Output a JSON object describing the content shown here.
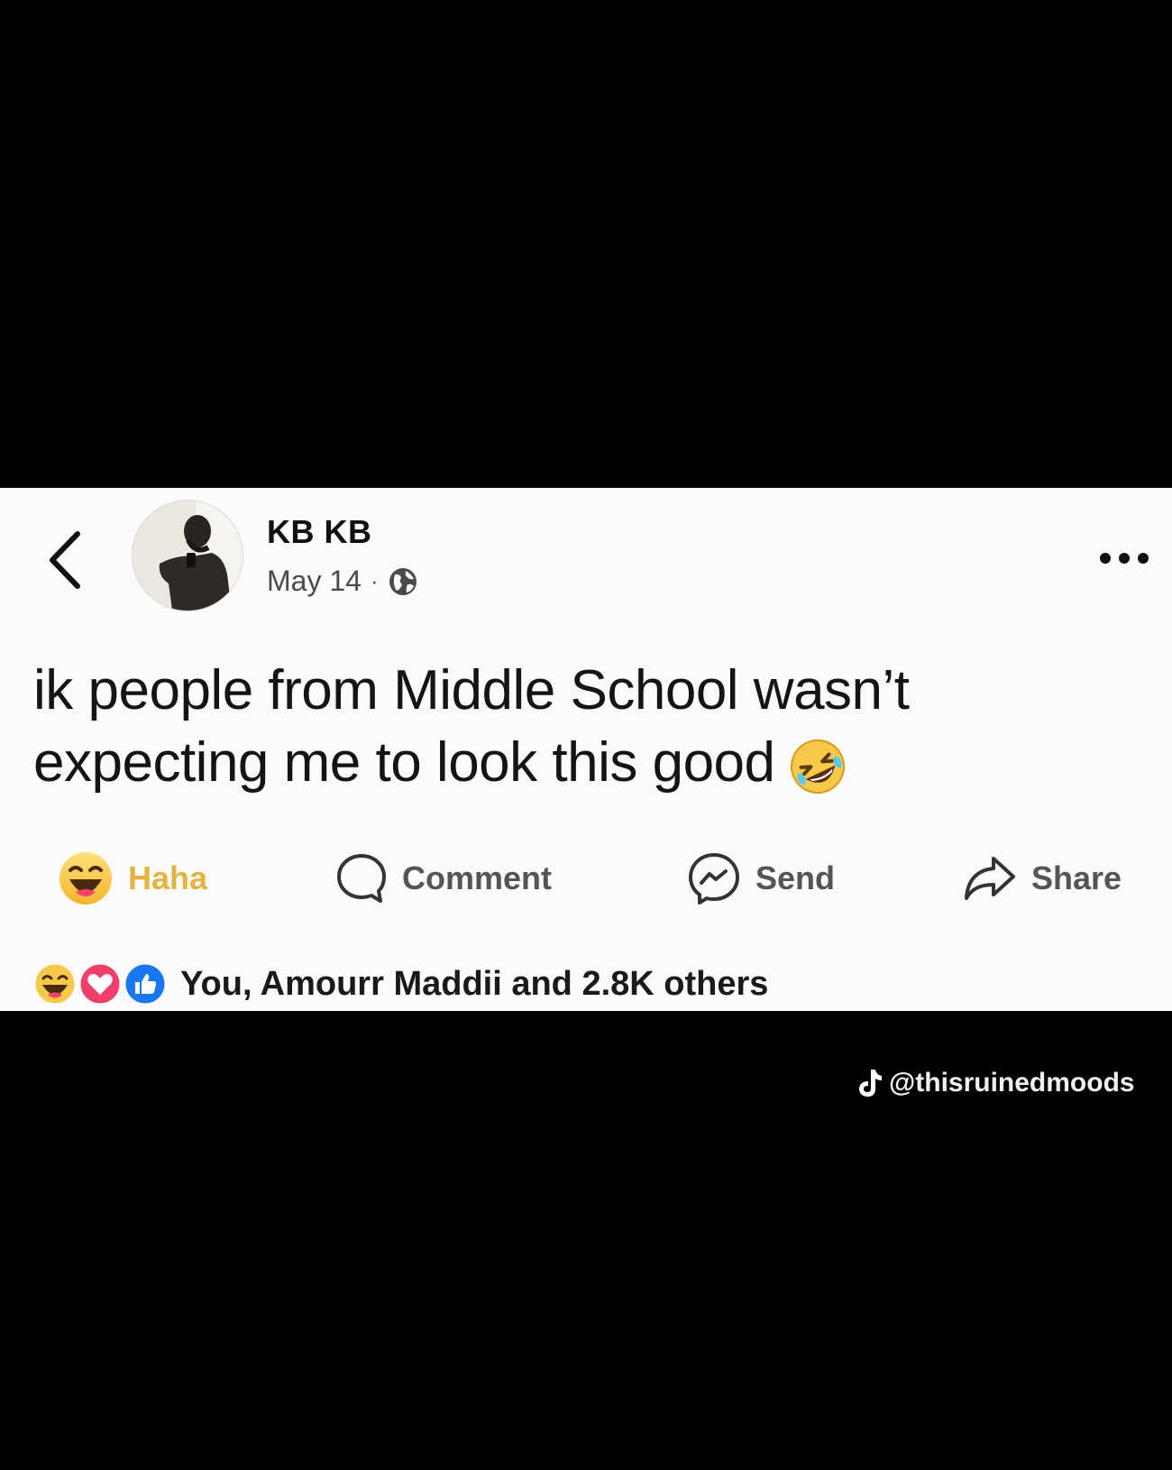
{
  "post": {
    "author": "KB KB",
    "date": "May 14",
    "separator": "·",
    "text_line1": "ik people from Middle School wasn’t",
    "text_line2": "expecting me to look this good"
  },
  "icons": {
    "back": "chevron-left-icon",
    "privacy": "globe-icon",
    "more": "more-horizontal-icon",
    "post_emoji": "rolling-on-floor-laughing-emoji",
    "haha": "haha-reaction-icon",
    "comment": "comment-bubble-icon",
    "send": "messenger-icon",
    "share": "share-arrow-icon",
    "tiktok": "tiktok-logo-icon"
  },
  "actions": {
    "haha_label": "Haha",
    "comment_label": "Comment",
    "send_label": "Send",
    "share_label": "Share"
  },
  "reactions": {
    "summary": "You, Amourr Maddii and 2.8K others"
  },
  "watermark": {
    "text": "@thisruinedmoods"
  },
  "colors": {
    "background": "#000000",
    "card": "#fbfbfb",
    "haha_yellow": "#e3b43f",
    "like_blue": "#1877f2",
    "love_red": "#f0406a"
  }
}
